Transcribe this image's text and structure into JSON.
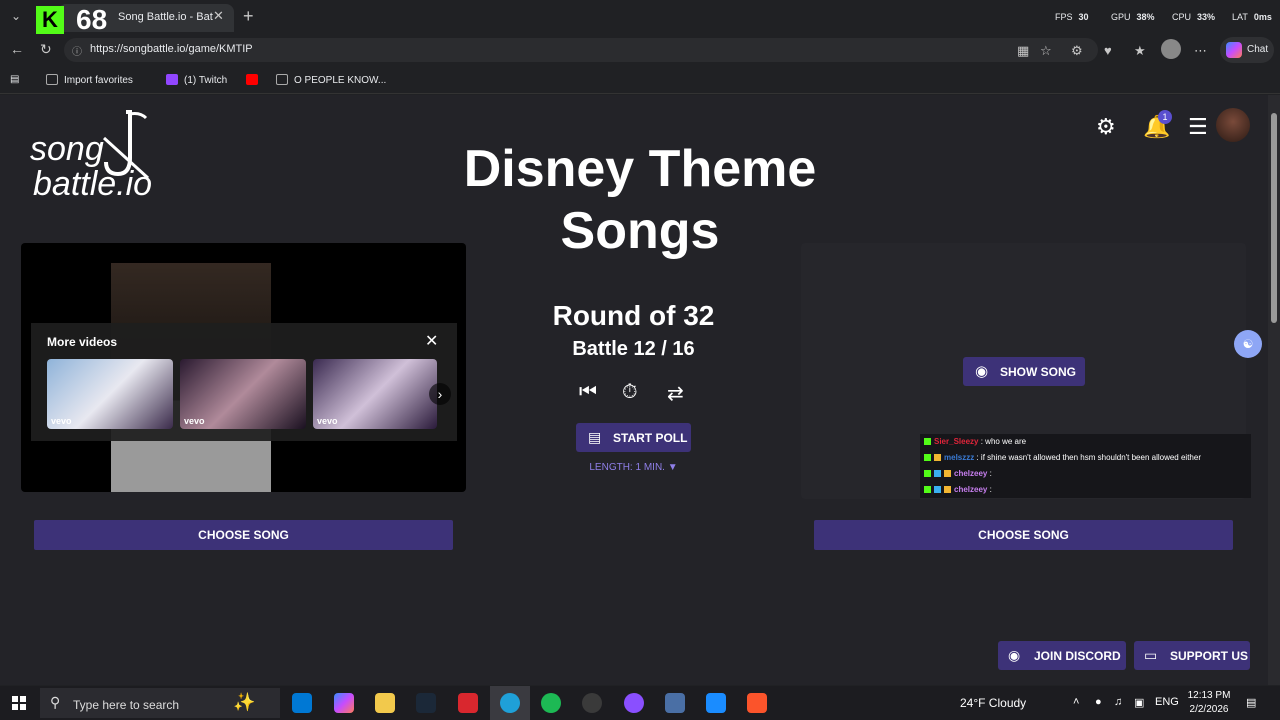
{
  "browser": {
    "kick_count": "68",
    "tab_title": "Song Battle.io - Battle Songs a",
    "stats": {
      "fps_label": "FPS",
      "fps": "30",
      "gpu_label": "GPU",
      "gpu": "38%",
      "cpu_label": "CPU",
      "cpu": "33%",
      "lat_label": "LAT",
      "lat": "0ms"
    },
    "url": "https://songbattle.io/game/KMTIP",
    "chat_label": "Chat",
    "favorites": [
      "Import favorites",
      "(1) Twitch",
      "O PEOPLE KNOW..."
    ]
  },
  "logo": {
    "line1": "song",
    "line2": "battle.io"
  },
  "title": "Disney Theme Songs",
  "notifications": {
    "count": "1"
  },
  "video": {
    "more_videos": "More videos",
    "thumbs": [
      "vevo",
      "vevo",
      "vevo"
    ]
  },
  "round": {
    "label": "Round of 32",
    "battle": "Battle 12 / 16"
  },
  "buttons": {
    "start_poll": "START POLL",
    "length": "LENGTH: 1 MIN. ▼",
    "show_song": "SHOW SONG",
    "choose_left": "CHOOSE SONG",
    "choose_right": "CHOOSE SONG",
    "join_discord": "JOIN DISCORD",
    "support_us": "SUPPORT US"
  },
  "chat": [
    {
      "user": "Sier_Sleezy",
      "msg": ": who we are",
      "color": "#e0243a"
    },
    {
      "user": "melszzz",
      "msg": ": if shine wasn't allowed then hsm shouldn't been allowed either",
      "color": "#3a7bd5"
    },
    {
      "user": "chelzeey",
      "msg": ":",
      "color": "#c87ff0"
    },
    {
      "user": "chelzeey",
      "msg": ":",
      "color": "#c87ff0"
    }
  ],
  "taskbar": {
    "search_placeholder": "Type here to search",
    "weather": "24°F  Cloudy",
    "lang": "ENG",
    "time": "12:13 PM",
    "date": "2/2/2026"
  },
  "colors": {
    "accent": "#3d3278",
    "page_bg": "#232328",
    "length_text": "#8f7fe8"
  }
}
